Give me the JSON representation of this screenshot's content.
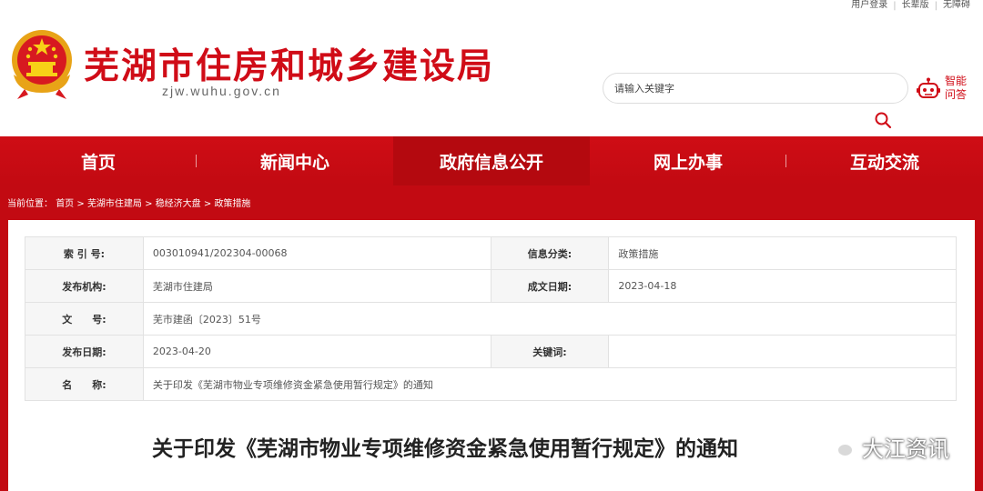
{
  "toplinks": [
    "用户登录",
    "长辈版",
    "无障碍"
  ],
  "header": {
    "title": "芜湖市住房和城乡建设局",
    "domain": "zjw.wuhu.gov.cn",
    "search_placeholder": "请输入关键字",
    "smart_qa_line1": "智能",
    "smart_qa_line2": "问答"
  },
  "nav": {
    "items": [
      "首页",
      "新闻中心",
      "政府信息公开",
      "网上办事",
      "互动交流"
    ],
    "active_index": 2
  },
  "breadcrumb": {
    "prefix": "当前位置：",
    "items": [
      "首页",
      "芜湖市住建局",
      "稳经济大盘",
      "政策措施"
    ],
    "separator": " > "
  },
  "info": {
    "index_label": "索 引 号:",
    "index_value": "003010941/202304-00068",
    "category_label": "信息分类:",
    "category_value": "政策措施",
    "publisher_label": "发布机构:",
    "publisher_value": "芜湖市住建局",
    "created_label": "成文日期:",
    "created_value": "2023-04-18",
    "docno_label": "文　　号:",
    "docno_value": "芜市建函〔2023〕51号",
    "pubdate_label": "发布日期:",
    "pubdate_value": "2023-04-20",
    "keywords_label": "关键词:",
    "keywords_value": "",
    "name_label": "名　　称:",
    "name_value": "关于印发《芜湖市物业专项维修资金紧急使用暂行规定》的通知"
  },
  "doc_title": "关于印发《芜湖市物业专项维修资金紧急使用暂行规定》的通知",
  "watermark": "大江资讯",
  "colors": {
    "brand_red": "#d00c17",
    "nav_red": "#c20a12",
    "nav_active": "#b4090f"
  }
}
